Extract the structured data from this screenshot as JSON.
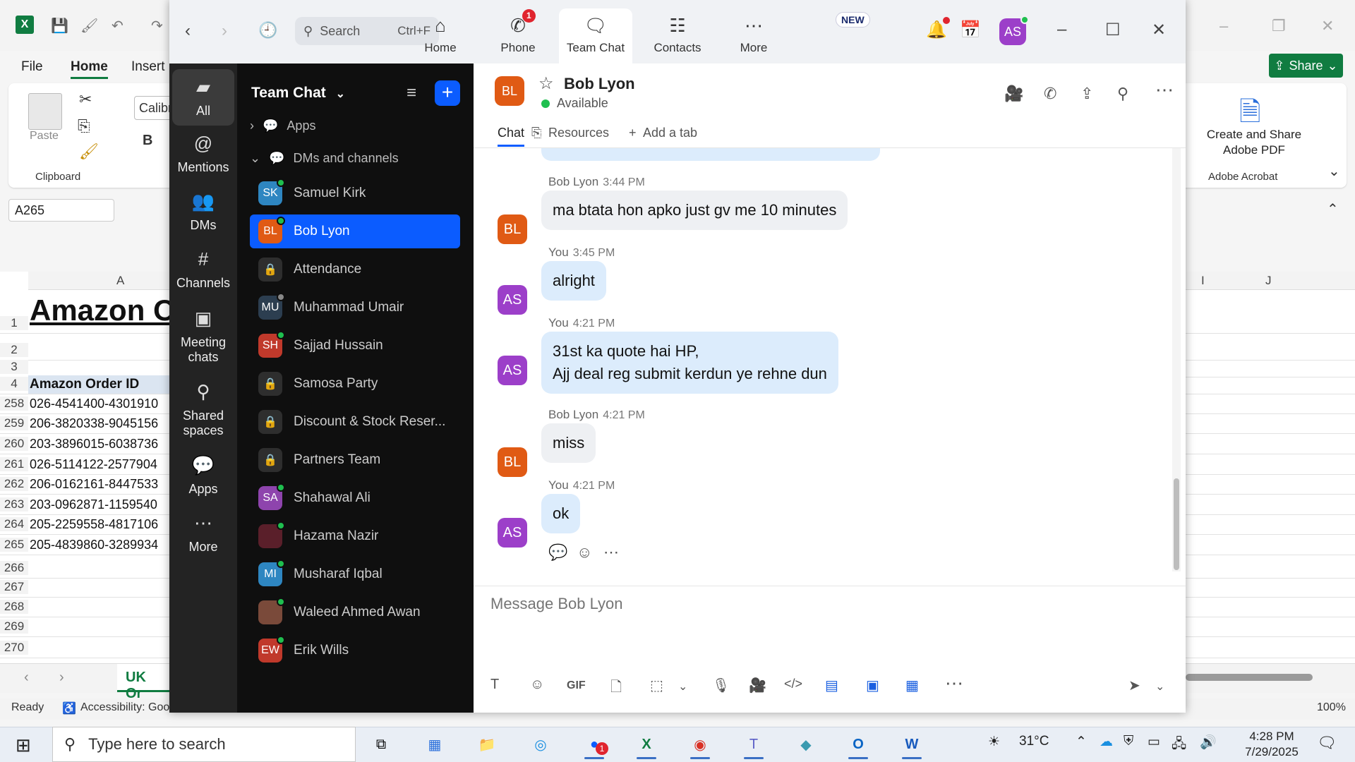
{
  "excel": {
    "logo": "X",
    "menus": [
      "File",
      "Home",
      "Insert"
    ],
    "share_label": "Share",
    "clipboard_label": "Clipboard",
    "paste_label": "Paste",
    "font_box": "Calibri",
    "bold": "B",
    "adobe_create": "Create and Share Adobe PDF",
    "adobe_group": "Adobe Acrobat",
    "name_box": "A265",
    "col_a": "A",
    "col_i": "I",
    "col_j": "J",
    "title_cell": "Amazon O",
    "header_cell": "Amazon Order ID",
    "rows": [
      {
        "num": "1",
        "val": ""
      },
      {
        "num": "2",
        "val": ""
      },
      {
        "num": "3",
        "val": ""
      },
      {
        "num": "4",
        "val": ""
      },
      {
        "num": "258",
        "val": "026-4541400-4301910"
      },
      {
        "num": "259",
        "val": "206-3820338-9045156"
      },
      {
        "num": "260",
        "val": "203-3896015-6038736"
      },
      {
        "num": "261",
        "val": "026-5114122-2577904"
      },
      {
        "num": "262",
        "val": "206-0162161-8447533"
      },
      {
        "num": "263",
        "val": "203-0962871-1159540"
      },
      {
        "num": "264",
        "val": "205-2259558-4817106"
      },
      {
        "num": "265",
        "val": "205-4839860-3289934"
      },
      {
        "num": "266",
        "val": ""
      },
      {
        "num": "267",
        "val": ""
      },
      {
        "num": "268",
        "val": ""
      },
      {
        "num": "269",
        "val": ""
      },
      {
        "num": "270",
        "val": ""
      }
    ],
    "sheet_tab": "UK Or",
    "status_ready": "Ready",
    "status_accessibility": "Accessibility: Good",
    "zoom": "100%"
  },
  "zoom": {
    "search_placeholder": "Search",
    "search_shortcut": "Ctrl+F",
    "tabs": [
      {
        "label": "Home",
        "icon": "home-icon",
        "glyph": "⌂"
      },
      {
        "label": "Phone",
        "icon": "phone-icon",
        "glyph": "✆",
        "badge": "1"
      },
      {
        "label": "Team Chat",
        "icon": "chat-icon",
        "glyph": "🗨"
      },
      {
        "label": "Contacts",
        "icon": "contacts-icon",
        "glyph": "☷"
      },
      {
        "label": "More",
        "icon": "more-icon",
        "glyph": "⋯",
        "new": "NEW"
      }
    ],
    "user_initials": "AS",
    "rail": [
      {
        "label": "All",
        "glyph": "▰"
      },
      {
        "label": "Mentions",
        "glyph": "@"
      },
      {
        "label": "DMs",
        "glyph": "👥"
      },
      {
        "label": "Channels",
        "glyph": "#"
      },
      {
        "label": "Meeting chats",
        "glyph": "▣"
      },
      {
        "label": "Shared spaces",
        "glyph": "⚲"
      },
      {
        "label": "Apps",
        "glyph": "💬"
      },
      {
        "label": "More",
        "glyph": "⋯"
      }
    ],
    "panel_title": "Team Chat",
    "section_apps": "Apps",
    "section_dms": "DMs and channels",
    "items": [
      {
        "name": "Samuel Kirk",
        "initials": "SK",
        "color": "#2e86c1",
        "online": true
      },
      {
        "name": "Bob Lyon",
        "initials": "BL",
        "color": "#e05a14",
        "online": true,
        "active": true
      },
      {
        "name": "Attendance",
        "lock": true
      },
      {
        "name": "Muhammad Umair",
        "initials": "MU",
        "color": "#2c3e50",
        "online": false
      },
      {
        "name": "Sajjad Hussain",
        "initials": "SH",
        "color": "#c0392b",
        "online": true
      },
      {
        "name": "Samosa Party",
        "lock": true
      },
      {
        "name": "Discount & Stock Reser...",
        "lock": true
      },
      {
        "name": "Partners Team",
        "lock": true
      },
      {
        "name": "Shahawal Ali",
        "initials": "SA",
        "color": "#8e44ad",
        "online": true
      },
      {
        "name": "Hazama Nazir",
        "initials": "",
        "color": "#5a1f2a",
        "online": true
      },
      {
        "name": "Musharaf Iqbal",
        "initials": "MI",
        "color": "#2e86c1",
        "online": true
      },
      {
        "name": "Waleed Ahmed Awan",
        "initials": "",
        "color": "#7a4a3a",
        "online": true
      },
      {
        "name": "Erik Wills",
        "initials": "EW",
        "color": "#c0392b",
        "online": true
      }
    ],
    "chat": {
      "contact_name": "Bob Lyon",
      "contact_initials": "BL",
      "status": "Available",
      "subtabs": [
        "Chat",
        "Resources",
        "Add a tab"
      ],
      "messages": [
        {
          "sender": "Bob Lyon",
          "time": "3:44 PM",
          "initials": "BL",
          "mine": false,
          "lines": [
            "ma btata hon apko just gv me 10 minutes"
          ]
        },
        {
          "sender": "You",
          "time": "3:45 PM",
          "initials": "AS",
          "mine": true,
          "lines": [
            "alright"
          ]
        },
        {
          "sender": "You",
          "time": "4:21 PM",
          "initials": "AS",
          "mine": true,
          "lines": [
            "31st ka quote hai HP,",
            "Ajj deal reg submit kerdun ye rehne dun"
          ]
        },
        {
          "sender": "Bob Lyon",
          "time": "4:21 PM",
          "initials": "BL",
          "mine": false,
          "lines": [
            "miss"
          ]
        },
        {
          "sender": "You",
          "time": "4:21 PM",
          "initials": "AS",
          "mine": true,
          "lines": [
            "ok"
          ]
        }
      ],
      "compose_placeholder": "Message Bob Lyon"
    },
    "colors": {
      "accent": "#0b5cff",
      "bob": "#e05a14",
      "you": "#9c3fc9"
    }
  },
  "taskbar": {
    "search_placeholder": "Type here to search",
    "temperature": "31°C",
    "time": "4:28 PM",
    "date": "7/29/2025",
    "notification_count": "1"
  }
}
